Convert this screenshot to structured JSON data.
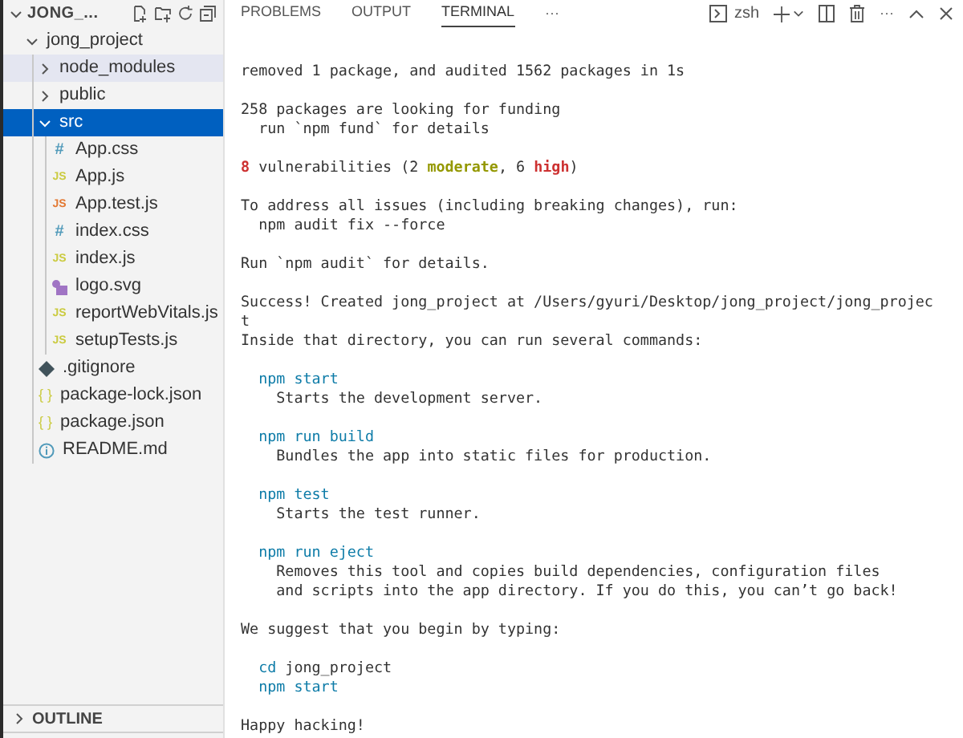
{
  "explorer": {
    "title": "JONG_...",
    "tree": [
      {
        "label": "jong_project",
        "kind": "folder",
        "expanded": true,
        "selected": false,
        "highlighted": false,
        "children": [
          {
            "label": "node_modules",
            "kind": "folder",
            "expanded": false,
            "selected": false,
            "highlighted": true
          },
          {
            "label": "public",
            "kind": "folder",
            "expanded": false,
            "selected": false,
            "highlighted": false
          },
          {
            "label": "src",
            "kind": "folder",
            "expanded": true,
            "selected": true,
            "highlighted": false,
            "children": [
              {
                "label": "App.css",
                "kind": "css",
                "icon": "#",
                "selected": false,
                "highlighted": false
              },
              {
                "label": "App.js",
                "kind": "js",
                "icon": "JS",
                "selected": false,
                "highlighted": false
              },
              {
                "label": "App.test.js",
                "kind": "test",
                "icon": "JS",
                "selected": false,
                "highlighted": false
              },
              {
                "label": "index.css",
                "kind": "css",
                "icon": "#",
                "selected": false,
                "highlighted": false
              },
              {
                "label": "index.js",
                "kind": "js",
                "icon": "JS",
                "selected": false,
                "highlighted": false
              },
              {
                "label": "logo.svg",
                "kind": "svg",
                "selected": false,
                "highlighted": false
              },
              {
                "label": "reportWebVitals.js",
                "kind": "js",
                "icon": "JS",
                "selected": false,
                "highlighted": false
              },
              {
                "label": "setupTests.js",
                "kind": "js",
                "icon": "JS",
                "selected": false,
                "highlighted": false
              }
            ]
          },
          {
            "label": ".gitignore",
            "kind": "git",
            "selected": false,
            "highlighted": false
          },
          {
            "label": "package-lock.json",
            "kind": "json",
            "icon": "{ }",
            "selected": false,
            "highlighted": false
          },
          {
            "label": "package.json",
            "kind": "json",
            "icon": "{ }",
            "selected": false,
            "highlighted": false
          },
          {
            "label": "README.md",
            "kind": "info",
            "selected": false,
            "highlighted": false
          }
        ]
      }
    ],
    "outline": {
      "label": "OUTLINE",
      "expanded": false
    }
  },
  "panel": {
    "tabs": [
      {
        "label": "PROBLEMS",
        "selected": false
      },
      {
        "label": "OUTPUT",
        "selected": false
      },
      {
        "label": "TERMINAL",
        "selected": true
      }
    ],
    "more": "···",
    "shell": "zsh",
    "toolbar_more": "···",
    "output": [
      [
        [
          {
            "text": "removed 1 package, and audited 1562 packages in 1s",
            "kind": "plain"
          }
        ]
      ],
      [
        [
          {
            "text": "258 packages are looking for funding",
            "kind": "plain"
          }
        ],
        [
          {
            "text": "  run `npm fund` for details",
            "kind": "plain"
          }
        ]
      ],
      [
        [
          {
            "text": "8",
            "kind": "error"
          },
          {
            "text": " vulnerabilities (2 ",
            "kind": "plain"
          },
          {
            "text": "moderate",
            "kind": "warning"
          },
          {
            "text": ", 6 ",
            "kind": "plain"
          },
          {
            "text": "high",
            "kind": "error"
          },
          {
            "text": ")",
            "kind": "plain"
          }
        ]
      ],
      [
        [
          {
            "text": "To address all issues (including breaking changes), run:",
            "kind": "plain"
          }
        ],
        [
          {
            "text": "  npm audit fix --force",
            "kind": "plain"
          }
        ]
      ],
      [
        [
          {
            "text": "Run `npm audit` for details.",
            "kind": "plain"
          }
        ]
      ],
      [
        [
          {
            "text": "Success! Created jong_project at /Users/gyuri/Desktop/jong_project/jong_projec",
            "kind": "plain"
          }
        ],
        [
          {
            "text": "t",
            "kind": "plain"
          }
        ],
        [
          {
            "text": "Inside that directory, you can run several commands:",
            "kind": "plain"
          }
        ]
      ],
      [
        [
          {
            "text": "  npm start",
            "kind": "command"
          }
        ],
        [
          {
            "text": "    Starts the development server.",
            "kind": "plain"
          }
        ]
      ],
      [
        [
          {
            "text": "  npm run build",
            "kind": "command"
          }
        ],
        [
          {
            "text": "    Bundles the app into static files for production.",
            "kind": "plain"
          }
        ]
      ],
      [
        [
          {
            "text": "  npm test",
            "kind": "command"
          }
        ],
        [
          {
            "text": "    Starts the test runner.",
            "kind": "plain"
          }
        ]
      ],
      [
        [
          {
            "text": "  npm run eject",
            "kind": "command"
          }
        ],
        [
          {
            "text": "    Removes this tool and copies build dependencies, configuration files",
            "kind": "plain"
          }
        ],
        [
          {
            "text": "    and scripts into the app directory. If you do this, you can’t go back!",
            "kind": "plain"
          }
        ]
      ],
      [
        [
          {
            "text": "We suggest that you begin by typing:",
            "kind": "plain"
          }
        ]
      ],
      [
        [
          {
            "text": "  cd",
            "kind": "command"
          },
          {
            "text": " jong_project",
            "kind": "plain"
          }
        ],
        [
          {
            "text": "  npm start",
            "kind": "command"
          }
        ]
      ],
      [
        [
          {
            "text": "Happy hacking!",
            "kind": "plain"
          }
        ]
      ]
    ]
  }
}
